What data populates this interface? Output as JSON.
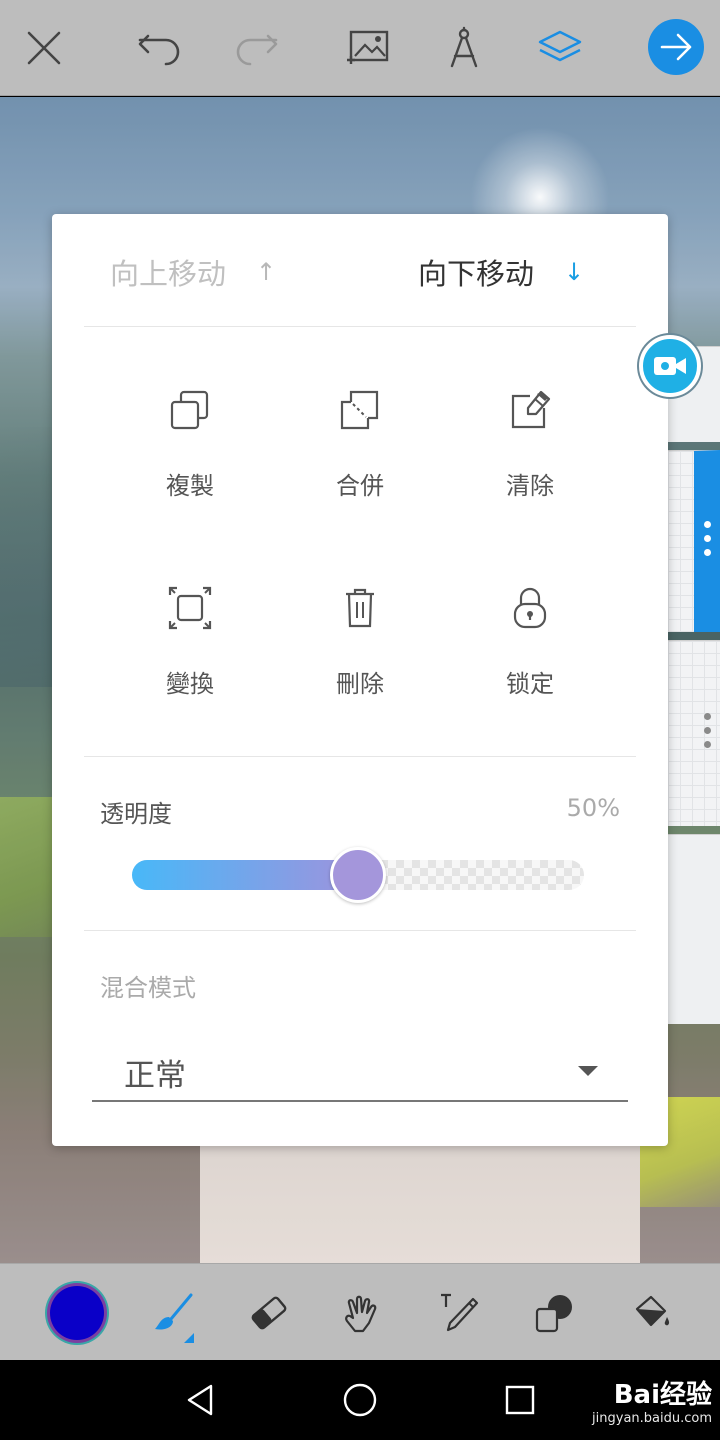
{
  "top_toolbar": {
    "icons": [
      "close-icon",
      "undo-icon",
      "redo-icon",
      "add-photo-icon",
      "drawing-compass-icon",
      "layers-icon",
      "arrow-right-icon"
    ],
    "accent_color": "#1a8ee3"
  },
  "layer_dialog": {
    "move_up_label": "向上移动",
    "move_up_arrow": "↑",
    "move_down_label": "向下移动",
    "move_down_arrow": "↓",
    "actions": [
      {
        "label": "複製",
        "icon": "duplicate-icon"
      },
      {
        "label": "合併",
        "icon": "merge-icon"
      },
      {
        "label": "清除",
        "icon": "clear-eraser-icon"
      },
      {
        "label": "變換",
        "icon": "transform-icon"
      },
      {
        "label": "刪除",
        "icon": "trash-icon"
      },
      {
        "label": "锁定",
        "icon": "lock-icon"
      }
    ],
    "opacity_label": "透明度",
    "opacity_value": "50%",
    "opacity_fraction": 0.5,
    "blend_mode_label": "混合模式",
    "blend_mode_value": "正常"
  },
  "bottom_toolbar": {
    "current_color": "#0a00c8",
    "tools": [
      "color-picker",
      "brush-icon",
      "eraser-icon",
      "smudge-icon",
      "text-icon",
      "shape-icon",
      "fill-bucket-icon"
    ]
  },
  "watermark": {
    "main": "Bai经验",
    "sub": "jingyan.baidu.com"
  }
}
